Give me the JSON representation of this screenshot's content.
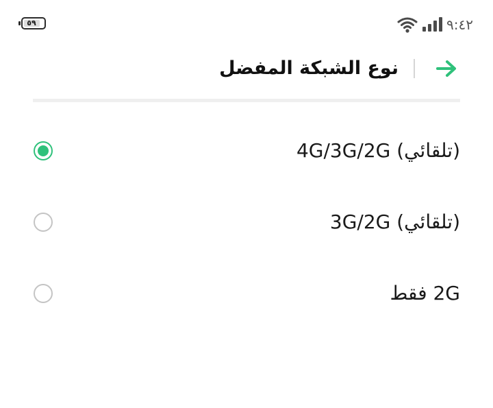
{
  "status_bar": {
    "battery_level": "٥٩",
    "time": "٩:٤٢",
    "icons": [
      "battery-icon",
      "wifi-icon",
      "cellular-signal-icon"
    ]
  },
  "header": {
    "title": "نوع الشبكة المفضل",
    "back_icon": "arrow-right-icon"
  },
  "options": [
    {
      "label": "(تلقائي) 4G/3G/2G",
      "selected": true
    },
    {
      "label": "(تلقائي) 3G/2G",
      "selected": false
    },
    {
      "label": "2G فقط",
      "selected": false
    }
  ],
  "colors": {
    "accent": "#2fc17b",
    "radio_border": "#c4c4c4",
    "divider": "#efefef"
  }
}
